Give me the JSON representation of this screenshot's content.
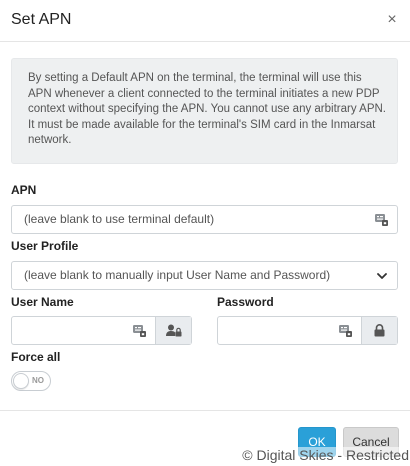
{
  "dialog": {
    "title": "Set APN",
    "close_label": "×",
    "description": "By setting a Default APN on the terminal, the terminal will use this APN whenever a client connected to the terminal initiates a new PDP context without specifying the APN. You cannot use any arbitrary APN. It must be made available for the terminal's SIM card in the Inmarsat network."
  },
  "apn": {
    "label": "APN",
    "placeholder": "(leave blank to use terminal default)",
    "value": "",
    "icon": "password-keyboard-icon"
  },
  "user_profile": {
    "label": "User Profile",
    "selected": "(leave blank to manually input User Name and Password)",
    "icon": "chevron-down-icon"
  },
  "user_name": {
    "label": "User Name",
    "value": "",
    "icons": [
      "password-keyboard-icon",
      "user-lock-icon"
    ]
  },
  "password": {
    "label": "Password",
    "value": "",
    "icons": [
      "password-keyboard-icon",
      "lock-icon"
    ]
  },
  "force_all": {
    "label": "Force all",
    "state": "NO"
  },
  "footer": {
    "ok_label": "OK",
    "cancel_label": "Cancel"
  },
  "watermark": "© Digital Skies - Restricted",
  "colors": {
    "primary": "#2aa0d8",
    "info_background": "#eef0f1",
    "addon_background": "#e9ecef"
  }
}
